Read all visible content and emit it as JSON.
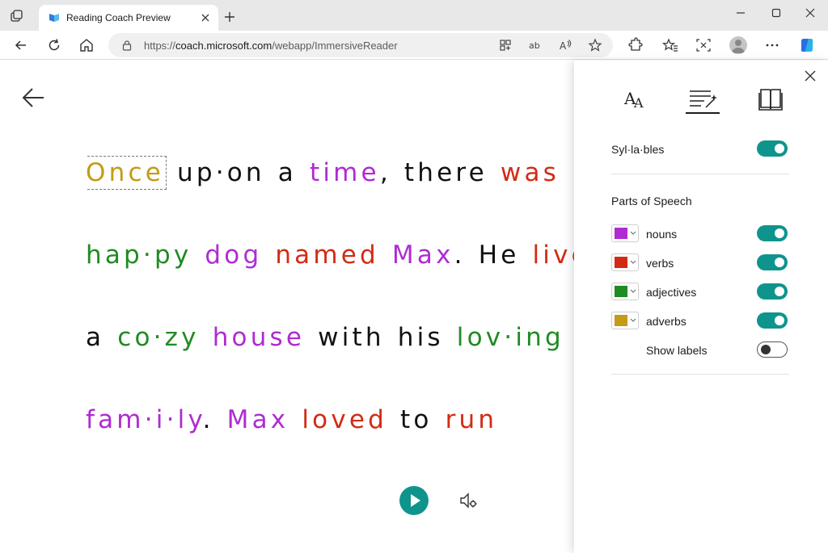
{
  "browser": {
    "tab_title": "Reading Coach Preview",
    "url_prefix": "https://",
    "url_domain": "coach.microsoft.com",
    "url_path": "/webapp/ImmersiveReader"
  },
  "reader": {
    "lines": [
      [
        {
          "t": "Once",
          "pos": "adv",
          "focus": true
        },
        {
          "t": "up·on",
          "pos": "plain"
        },
        {
          "t": "a",
          "pos": "plain"
        },
        {
          "t": "time",
          "pos": "noun",
          "suffix": ","
        },
        {
          "t": "there",
          "pos": "plain"
        },
        {
          "t": "was",
          "pos": "verb"
        }
      ],
      [
        {
          "t": "hap·py",
          "pos": "adj"
        },
        {
          "t": "dog",
          "pos": "noun"
        },
        {
          "t": "named",
          "pos": "verb"
        },
        {
          "t": "Max",
          "pos": "noun",
          "suffix": "."
        },
        {
          "t": "He",
          "pos": "plain"
        },
        {
          "t": "lived",
          "pos": "verb"
        }
      ],
      [
        {
          "t": "a",
          "pos": "plain"
        },
        {
          "t": "co·zy",
          "pos": "adj"
        },
        {
          "t": "house",
          "pos": "noun"
        },
        {
          "t": "with",
          "pos": "plain"
        },
        {
          "t": "his",
          "pos": "plain"
        },
        {
          "t": "lov·ing",
          "pos": "adj"
        }
      ],
      [
        {
          "t": "fam·i·ly",
          "pos": "noun",
          "suffix": "."
        },
        {
          "t": "Max",
          "pos": "noun"
        },
        {
          "t": "loved",
          "pos": "verb"
        },
        {
          "t": "to",
          "pos": "plain"
        },
        {
          "t": "run",
          "pos": "verb"
        }
      ]
    ]
  },
  "panel": {
    "syllables_label": "Syl·la·bles",
    "syllables_on": true,
    "parts_of_speech_title": "Parts of Speech",
    "parts": [
      {
        "label": "nouns",
        "color": "#b02bd2",
        "on": true
      },
      {
        "label": "verbs",
        "color": "#d22b14",
        "on": true
      },
      {
        "label": "adjectives",
        "color": "#1f8b23",
        "on": true
      },
      {
        "label": "adverbs",
        "color": "#c49a18",
        "on": true
      }
    ],
    "show_labels": "Show labels",
    "show_labels_on": false
  },
  "colors": {
    "accent": "#0f948d"
  }
}
